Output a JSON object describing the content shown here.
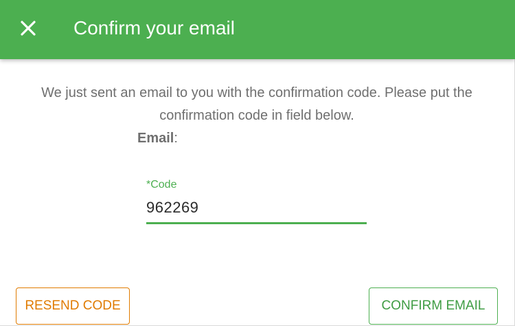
{
  "dialog": {
    "title": "Confirm your email",
    "close_icon": "close-icon",
    "message": "We just sent an email to you with the confirmation code. Please put the confirmation code in field below.",
    "email_label": "Email",
    "email_separator": ":",
    "email_value": ""
  },
  "code_field": {
    "label": "*Code",
    "value": "962269"
  },
  "buttons": {
    "resend_label": "RESEND CODE",
    "confirm_label": "CONFIRM EMAIL"
  },
  "colors": {
    "header": "#4caf50",
    "accent_green": "#4caf50",
    "resend_orange": "#e07b00",
    "body_text": "#6f6f6f"
  }
}
